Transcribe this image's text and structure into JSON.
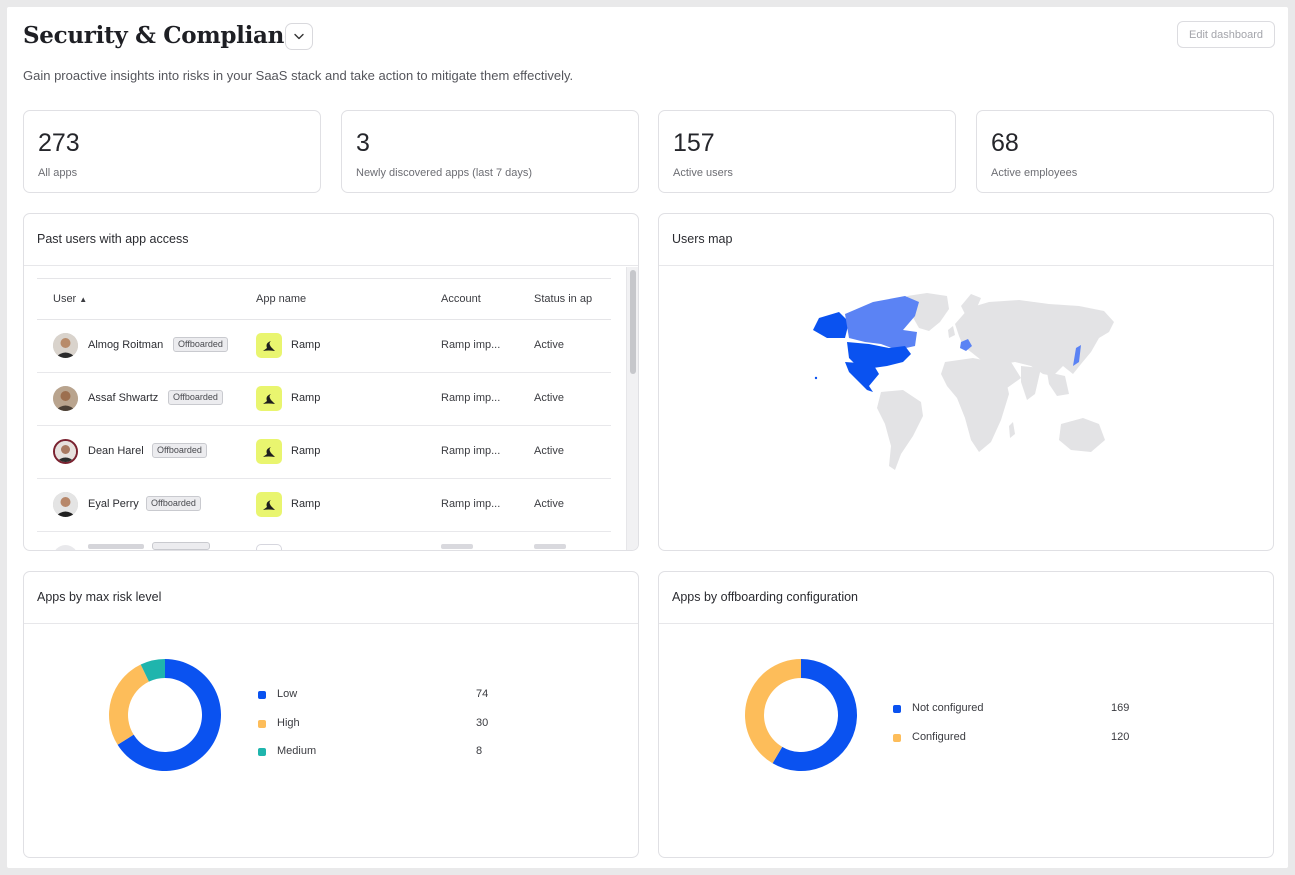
{
  "header": {
    "title": "Security & Compliance",
    "subtitle": "Gain proactive insights into risks in your SaaS stack and take action to mitigate them effectively.",
    "edit_label": "Edit dashboard"
  },
  "stats": [
    {
      "value": "273",
      "label": "All apps"
    },
    {
      "value": "3",
      "label": "Newly discovered apps (last 7 days)"
    },
    {
      "value": "157",
      "label": "Active users"
    },
    {
      "value": "68",
      "label": "Active employees"
    }
  ],
  "past_users": {
    "title": "Past users with app access",
    "columns": {
      "user": "User",
      "sort": "▲",
      "app": "App name",
      "account": "Account",
      "status": "Status in ap"
    },
    "rows": [
      {
        "user": "Almog Roitman",
        "badge": "Offboarded",
        "app": "Ramp",
        "account": "Ramp imp...",
        "status": "Active"
      },
      {
        "user": "Assaf Shwartz",
        "badge": "Offboarded",
        "app": "Ramp",
        "account": "Ramp imp...",
        "status": "Active"
      },
      {
        "user": "Dean Harel",
        "badge": "Offboarded",
        "app": "Ramp",
        "account": "Ramp imp...",
        "status": "Active"
      },
      {
        "user": "Eyal Perry",
        "badge": "Offboarded",
        "app": "Ramp",
        "account": "Ramp imp...",
        "status": "Active"
      }
    ]
  },
  "users_map": {
    "title": "Users map"
  },
  "risk_chart": {
    "title": "Apps by max risk level",
    "chart_data": {
      "type": "pie",
      "labels": [
        "Low",
        "High",
        "Medium"
      ],
      "values": [
        74,
        30,
        8
      ],
      "colors": [
        "#0a52f0",
        "#fdbd5a",
        "#1fb5ad"
      ]
    }
  },
  "offboarding_chart": {
    "title": "Apps by offboarding configuration",
    "chart_data": {
      "type": "pie",
      "labels": [
        "Not configured",
        "Configured"
      ],
      "values": [
        169,
        120
      ],
      "colors": [
        "#0a52f0",
        "#fdbd5a"
      ]
    }
  }
}
